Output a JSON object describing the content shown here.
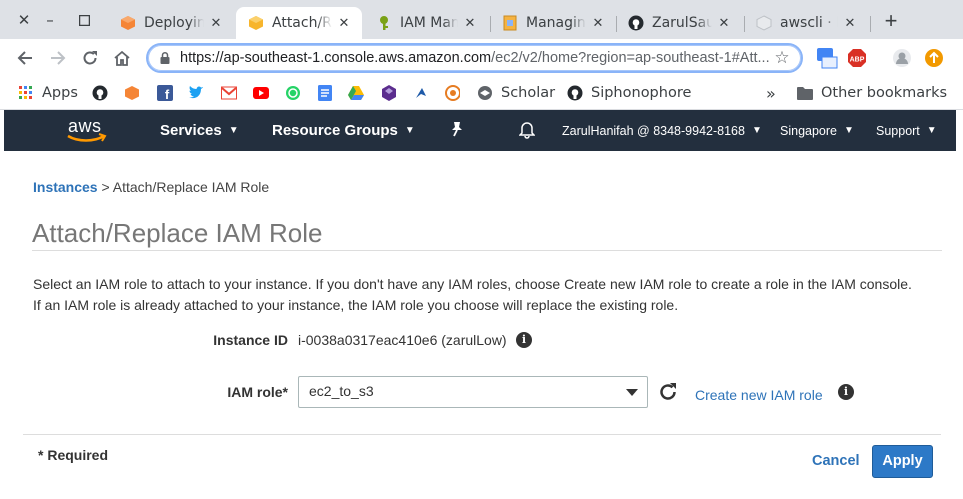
{
  "browser": {
    "tabs": [
      {
        "title": "Deploying",
        "favicon": "aws-orange-cube-icon",
        "active": false
      },
      {
        "title": "Attach/Replace",
        "favicon": "aws-yellow-box-icon",
        "active": true
      },
      {
        "title": "IAM Mana",
        "favicon": "iam-key-icon",
        "active": false
      },
      {
        "title": "Managing",
        "favicon": "document-icon",
        "active": false
      },
      {
        "title": "ZarulSau",
        "favicon": "github-icon",
        "active": false
      },
      {
        "title": "awscli · P",
        "favicon": "package-icon",
        "active": false
      }
    ],
    "url_host": "https://ap-southeast-1.console.aws.amazon.com",
    "url_rest": "/ec2/v2/home?region=ap-southeast-1#Att...",
    "bookmarks": [
      {
        "label": "Apps",
        "icon": "apps-grid-icon"
      },
      {
        "label": "",
        "icon": "github-icon"
      },
      {
        "label": "",
        "icon": "aws-cube-icon"
      },
      {
        "label": "",
        "icon": "facebook-icon"
      },
      {
        "label": "",
        "icon": "twitter-icon"
      },
      {
        "label": "",
        "icon": "gmail-icon"
      },
      {
        "label": "",
        "icon": "youtube-icon"
      },
      {
        "label": "",
        "icon": "whatsapp-icon"
      },
      {
        "label": "",
        "icon": "docs-icon"
      },
      {
        "label": "",
        "icon": "drive-icon"
      },
      {
        "label": "",
        "icon": "gem-icon"
      },
      {
        "label": "",
        "icon": "bird-icon"
      },
      {
        "label": "",
        "icon": "eye-icon"
      },
      {
        "label": "Scholar",
        "icon": "scholar-icon"
      },
      {
        "label": "Siphonophore",
        "icon": "github-icon"
      }
    ],
    "bookmarks_overflow": "»",
    "other_bookmarks": "Other bookmarks"
  },
  "aws_nav": {
    "logo": "aws",
    "services": "Services",
    "resource_groups": "Resource Groups",
    "account": "ZarulHanifah @ 8348-9942-8168",
    "region": "Singapore",
    "support": "Support"
  },
  "page": {
    "breadcrumb_link": "Instances",
    "breadcrumb_sep": " > ",
    "breadcrumb_current": "Attach/Replace IAM Role",
    "title": "Attach/Replace IAM Role",
    "description_line1": "Select an IAM role to attach to your instance. If you don't have any IAM roles, choose Create new IAM role to create a role in the IAM console.",
    "description_line2": "If an IAM role is already attached to your instance, the IAM role you choose will replace the existing role.",
    "instance_id_label": "Instance ID",
    "instance_id_value": "i-0038a0317eac410e6 (zarulLow)",
    "iam_role_label": "IAM role*",
    "iam_role_selected": "ec2_to_s3",
    "create_role_link": "Create new IAM role",
    "required_note": "* Required",
    "cancel": "Cancel",
    "apply": "Apply"
  },
  "colors": {
    "aws_nav_bg": "#232f3e",
    "link_blue": "#2e73b8",
    "apply_blue": "#2d79c7"
  }
}
